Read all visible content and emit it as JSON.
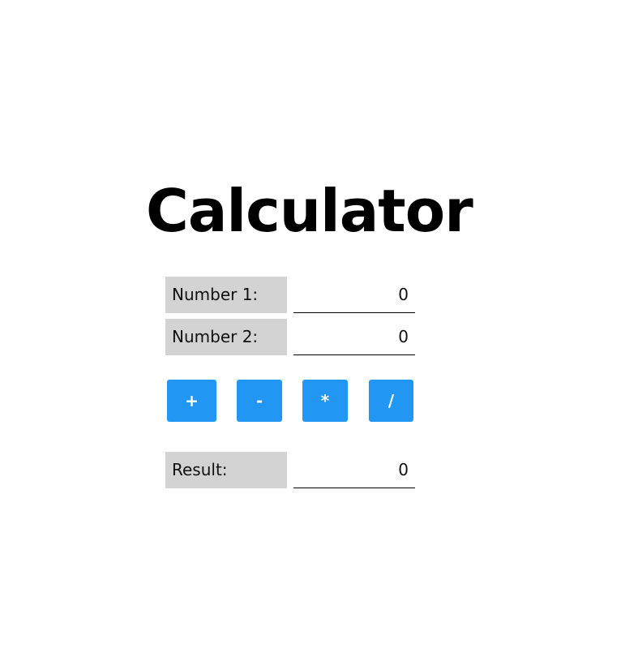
{
  "app": {
    "title": "Calculator"
  },
  "fields": {
    "number1": {
      "label": "Number 1:",
      "value": "0"
    },
    "number2": {
      "label": "Number 2:",
      "value": "0"
    },
    "result": {
      "label": "Result:",
      "value": "0"
    }
  },
  "operations": {
    "add": "+",
    "subtract": "-",
    "multiply": "*",
    "divide": "/"
  },
  "colors": {
    "button_bg": "#2196f3",
    "button_text": "#ffffff",
    "label_bg": "#d3d3d3"
  }
}
